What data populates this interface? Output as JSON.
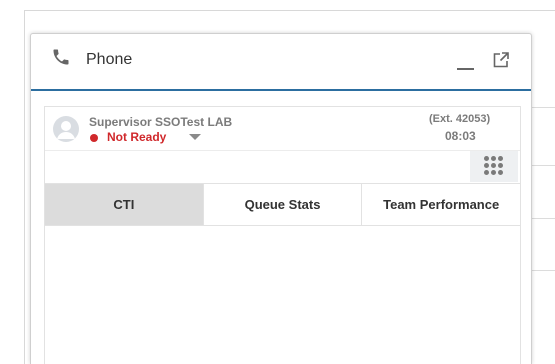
{
  "window": {
    "title": "Phone"
  },
  "agent": {
    "name": "Supervisor SSOTest LAB",
    "status": "Not Ready",
    "status_color": "#d0282b",
    "extension": "(Ext. 42053)",
    "timer": "08:03"
  },
  "tabs": [
    {
      "label": "CTI",
      "active": true
    },
    {
      "label": "Queue Stats",
      "active": false
    },
    {
      "label": "Team Performance",
      "active": false
    }
  ],
  "background": {
    "partial_text": ""
  },
  "icons": {
    "phone": "phone-icon",
    "minimize": "minimize-icon",
    "popout": "external-link-icon",
    "avatar": "user-avatar-icon",
    "dialpad": "dialpad-icon",
    "status_caret": "caret-down-icon"
  },
  "colors": {
    "header_accent": "#2c6ea0",
    "active_tab": "#dcdcdc"
  }
}
